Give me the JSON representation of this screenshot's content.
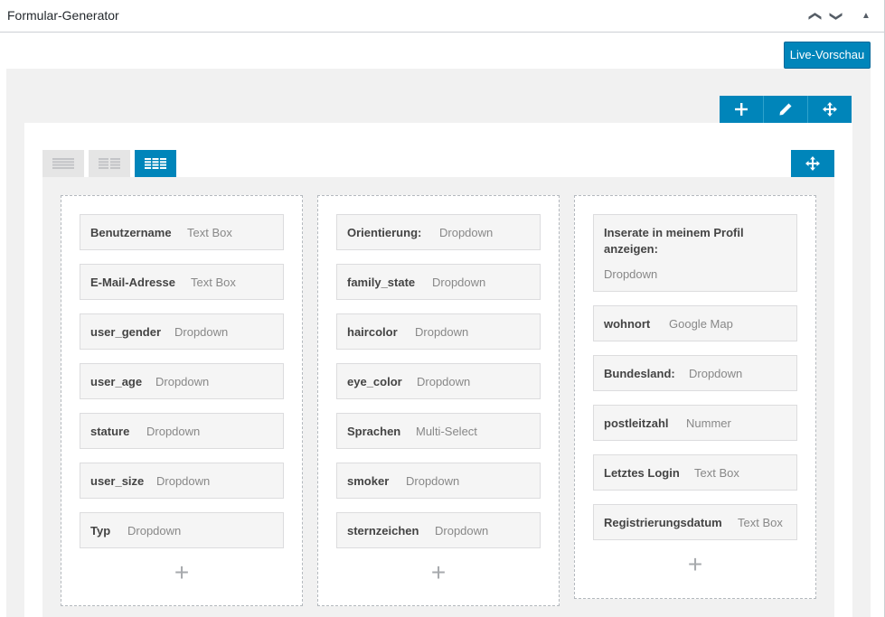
{
  "header": {
    "title": "Formular-Generator",
    "up_glyph": "❯",
    "down_glyph": "❯",
    "collapse_glyph": "▲"
  },
  "toolbar": {
    "preview_label": "Live-Vorschau"
  },
  "row_tools": {
    "add_icon": "plus-icon",
    "edit_icon": "pencil-icon",
    "move_icon": "move-icon"
  },
  "columns": [
    {
      "fields": [
        {
          "name": "Benutzername",
          "type": "Text Box"
        },
        {
          "name": "E-Mail-Adresse",
          "type": "Text Box"
        },
        {
          "name": "user_gender",
          "type": "Dropdown"
        },
        {
          "name": "user_age",
          "type": "Dropdown"
        },
        {
          "name": "stature",
          "type": "Dropdown"
        },
        {
          "name": "user_size",
          "type": "Dropdown"
        },
        {
          "name": "Typ",
          "type": "Dropdown"
        }
      ],
      "add_label": "+"
    },
    {
      "fields": [
        {
          "name": "Orientierung:",
          "type": "Dropdown"
        },
        {
          "name": "family_state",
          "type": "Dropdown"
        },
        {
          "name": "haircolor",
          "type": "Dropdown"
        },
        {
          "name": "eye_color",
          "type": "Dropdown"
        },
        {
          "name": "Sprachen",
          "type": "Multi-Select"
        },
        {
          "name": "smoker",
          "type": "Dropdown"
        },
        {
          "name": "sternzeichen",
          "type": "Dropdown"
        }
      ],
      "add_label": "+"
    },
    {
      "fields": [
        {
          "name": "Inserate in meinem Profil anzeigen:",
          "type": "Dropdown"
        },
        {
          "name": "wohnort",
          "type": "Google Map"
        },
        {
          "name": "Bundesland:",
          "type": "Dropdown"
        },
        {
          "name": "postleitzahl",
          "type": "Nummer"
        },
        {
          "name": "Letztes Login",
          "type": "Text Box"
        },
        {
          "name": "Registrierungsdatum",
          "type": "Text Box"
        }
      ],
      "add_label": "+"
    }
  ],
  "colors": {
    "accent": "#0085ba",
    "panel": "#f1f1f1",
    "field_bg": "#f5f5f5"
  }
}
